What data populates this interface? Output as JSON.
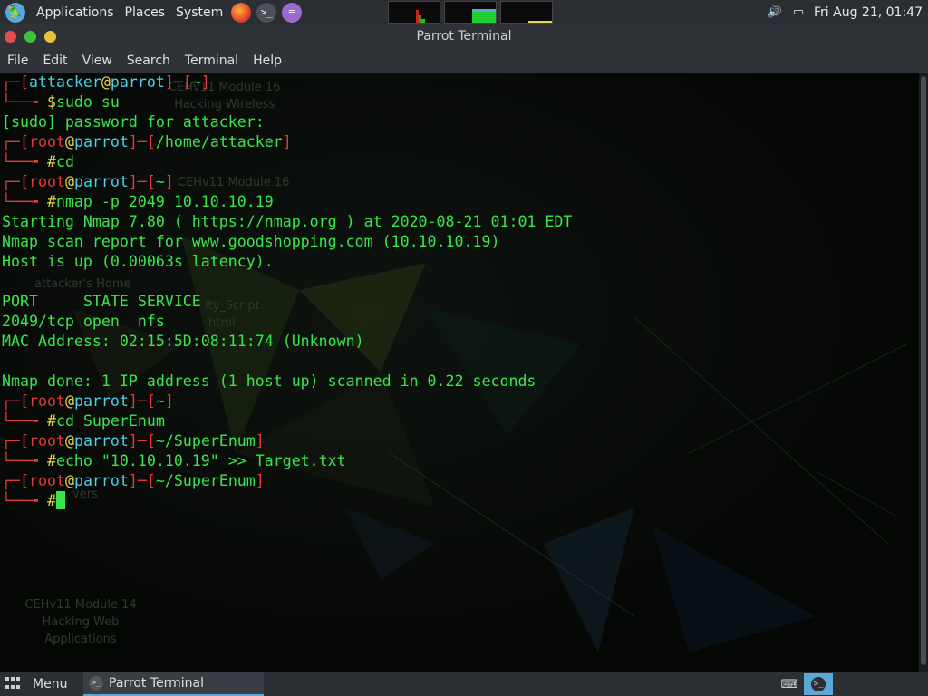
{
  "top_panel": {
    "menus": [
      "Applications",
      "Places",
      "System"
    ],
    "datetime": "Fri Aug 21, 01:47"
  },
  "window": {
    "title": "Parrot Terminal",
    "menu": [
      "File",
      "Edit",
      "View",
      "Search",
      "Terminal",
      "Help"
    ]
  },
  "terminal": {
    "lines": [
      {
        "type": "prompt",
        "user": "attacker",
        "host": "parrot",
        "dir": "~"
      },
      {
        "type": "cmd",
        "symbol": "$",
        "text": "sudo su"
      },
      {
        "type": "out",
        "text": "[sudo] password for attacker:"
      },
      {
        "type": "prompt",
        "user": "root",
        "host": "parrot",
        "dir": "/home/attacker"
      },
      {
        "type": "cmd",
        "symbol": "#",
        "text": "cd"
      },
      {
        "type": "prompt",
        "user": "root",
        "host": "parrot",
        "dir": "~"
      },
      {
        "type": "cmd",
        "symbol": "#",
        "text": "nmap -p 2049 10.10.10.19"
      },
      {
        "type": "out",
        "text": "Starting Nmap 7.80 ( https://nmap.org ) at 2020-08-21 01:01 EDT"
      },
      {
        "type": "out",
        "text": "Nmap scan report for www.goodshopping.com (10.10.10.19)"
      },
      {
        "type": "out",
        "text": "Host is up (0.00063s latency)."
      },
      {
        "type": "out",
        "text": ""
      },
      {
        "type": "out",
        "text": "PORT     STATE SERVICE"
      },
      {
        "type": "out",
        "text": "2049/tcp open  nfs"
      },
      {
        "type": "out",
        "text": "MAC Address: 02:15:5D:08:11:74 (Unknown)"
      },
      {
        "type": "out",
        "text": ""
      },
      {
        "type": "out",
        "text": "Nmap done: 1 IP address (1 host up) scanned in 0.22 seconds"
      },
      {
        "type": "prompt",
        "user": "root",
        "host": "parrot",
        "dir": "~"
      },
      {
        "type": "cmd",
        "symbol": "#",
        "text": "cd SuperEnum"
      },
      {
        "type": "prompt",
        "user": "root",
        "host": "parrot",
        "dir": "~/SuperEnum"
      },
      {
        "type": "cmd",
        "symbol": "#",
        "text": "echo \"10.10.10.19\" >> Target.txt"
      },
      {
        "type": "prompt",
        "user": "root",
        "host": "parrot",
        "dir": "~/SuperEnum"
      },
      {
        "type": "cursor",
        "symbol": "#",
        "text": ""
      }
    ]
  },
  "desktop_icons": [
    {
      "lines": [
        "CEHv11 Module 16",
        "Hacking Wireless"
      ]
    },
    {
      "lines": [
        "CEHv11 Module 16"
      ]
    },
    {
      "lines": [
        "attacker's Home"
      ]
    },
    {
      "lines": [
        "ity_Script",
        "html"
      ]
    },
    {
      "lines": [
        "vers"
      ]
    },
    {
      "lines": [
        "CEHv11 Module 14",
        "Hacking Web",
        "Applications"
      ]
    }
  ],
  "bottom_panel": {
    "menu_label": "Menu",
    "task_label": "Parrot Terminal"
  },
  "colors": {
    "prompt_bracket": "#e03a3a",
    "host": "#47d2e8",
    "symbol": "#e6d84a",
    "output": "#39e64a"
  },
  "icons": [
    "parrot-logo-icon",
    "firefox-icon",
    "terminal-icon",
    "text-editor-icon",
    "volume-icon",
    "display-icon",
    "grid-menu-icon",
    "keyboard-icon"
  ]
}
